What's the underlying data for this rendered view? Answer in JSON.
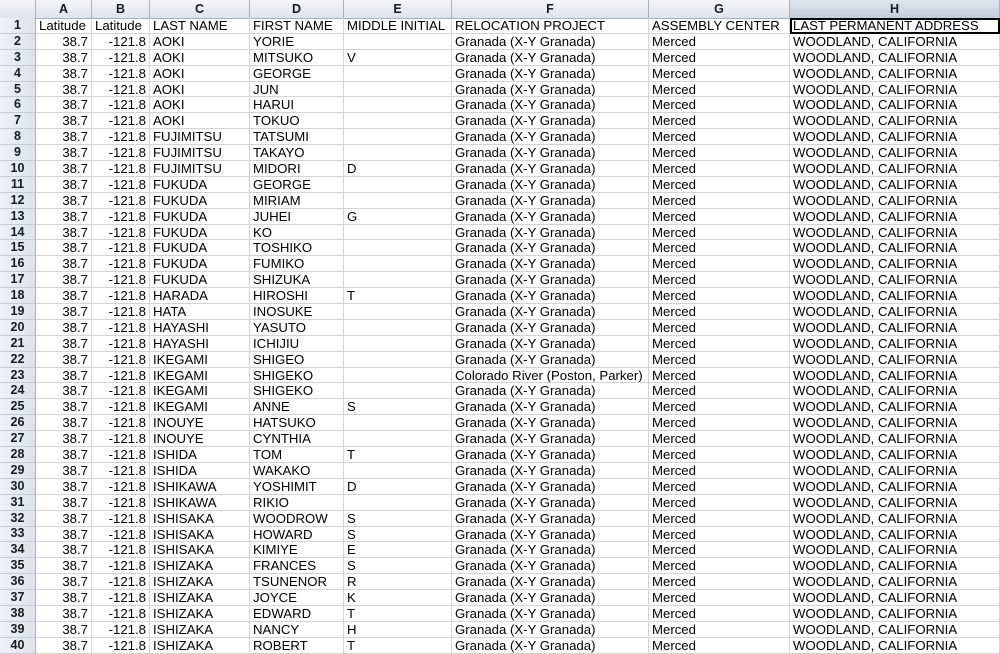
{
  "columns": [
    {
      "letter": "A"
    },
    {
      "letter": "B"
    },
    {
      "letter": "C"
    },
    {
      "letter": "D"
    },
    {
      "letter": "E"
    },
    {
      "letter": "F"
    },
    {
      "letter": "G"
    },
    {
      "letter": "H"
    }
  ],
  "header": [
    "Latitude",
    "Latitude",
    "LAST NAME",
    "FIRST NAME",
    "MIDDLE INITIAL",
    "RELOCATION PROJECT",
    "ASSEMBLY CENTER",
    "LAST PERMANENT ADDRESS"
  ],
  "rows": [
    [
      "2",
      "38.7",
      "-121.8",
      "AOKI",
      "YORIE",
      "",
      "Granada (X-Y Granada)",
      "Merced",
      "WOODLAND, CALIFORNIA"
    ],
    [
      "3",
      "38.7",
      "-121.8",
      "AOKI",
      "MITSUKO",
      "V",
      "Granada (X-Y Granada)",
      "Merced",
      "WOODLAND, CALIFORNIA"
    ],
    [
      "4",
      "38.7",
      "-121.8",
      "AOKI",
      "GEORGE",
      "",
      "Granada (X-Y Granada)",
      "Merced",
      "WOODLAND, CALIFORNIA"
    ],
    [
      "5",
      "38.7",
      "-121.8",
      "AOKI",
      "JUN",
      "",
      "Granada (X-Y Granada)",
      "Merced",
      "WOODLAND, CALIFORNIA"
    ],
    [
      "6",
      "38.7",
      "-121.8",
      "AOKI",
      "HARUI",
      "",
      "Granada (X-Y Granada)",
      "Merced",
      "WOODLAND, CALIFORNIA"
    ],
    [
      "7",
      "38.7",
      "-121.8",
      "AOKI",
      "TOKUO",
      "",
      "Granada (X-Y Granada)",
      "Merced",
      "WOODLAND, CALIFORNIA"
    ],
    [
      "8",
      "38.7",
      "-121.8",
      "FUJIMITSU",
      "TATSUMI",
      "",
      "Granada (X-Y Granada)",
      "Merced",
      "WOODLAND, CALIFORNIA"
    ],
    [
      "9",
      "38.7",
      "-121.8",
      "FUJIMITSU",
      "TAKAYO",
      "",
      "Granada (X-Y Granada)",
      "Merced",
      "WOODLAND, CALIFORNIA"
    ],
    [
      "10",
      "38.7",
      "-121.8",
      "FUJIMITSU",
      "MIDORI",
      "D",
      "Granada (X-Y Granada)",
      "Merced",
      "WOODLAND, CALIFORNIA"
    ],
    [
      "11",
      "38.7",
      "-121.8",
      "FUKUDA",
      "GEORGE",
      "",
      "Granada (X-Y Granada)",
      "Merced",
      "WOODLAND, CALIFORNIA"
    ],
    [
      "12",
      "38.7",
      "-121.8",
      "FUKUDA",
      "MIRIAM",
      "",
      "Granada (X-Y Granada)",
      "Merced",
      "WOODLAND, CALIFORNIA"
    ],
    [
      "13",
      "38.7",
      "-121.8",
      "FUKUDA",
      "JUHEI",
      "G",
      "Granada (X-Y Granada)",
      "Merced",
      "WOODLAND, CALIFORNIA"
    ],
    [
      "14",
      "38.7",
      "-121.8",
      "FUKUDA",
      "KO",
      "",
      "Granada (X-Y Granada)",
      "Merced",
      "WOODLAND, CALIFORNIA"
    ],
    [
      "15",
      "38.7",
      "-121.8",
      "FUKUDA",
      "TOSHIKO",
      "",
      "Granada (X-Y Granada)",
      "Merced",
      "WOODLAND, CALIFORNIA"
    ],
    [
      "16",
      "38.7",
      "-121.8",
      "FUKUDA",
      "FUMIKO",
      "",
      "Granada (X-Y Granada)",
      "Merced",
      "WOODLAND, CALIFORNIA"
    ],
    [
      "17",
      "38.7",
      "-121.8",
      "FUKUDA",
      "SHIZUKA",
      "",
      "Granada (X-Y Granada)",
      "Merced",
      "WOODLAND, CALIFORNIA"
    ],
    [
      "18",
      "38.7",
      "-121.8",
      "HARADA",
      "HIROSHI",
      "T",
      "Granada (X-Y Granada)",
      "Merced",
      "WOODLAND, CALIFORNIA"
    ],
    [
      "19",
      "38.7",
      "-121.8",
      "HATA",
      "INOSUKE",
      "",
      "Granada (X-Y Granada)",
      "Merced",
      "WOODLAND, CALIFORNIA"
    ],
    [
      "20",
      "38.7",
      "-121.8",
      "HAYASHI",
      "YASUTO",
      "",
      "Granada (X-Y Granada)",
      "Merced",
      "WOODLAND, CALIFORNIA"
    ],
    [
      "21",
      "38.7",
      "-121.8",
      "HAYASHI",
      "ICHIJIU",
      "",
      "Granada (X-Y Granada)",
      "Merced",
      "WOODLAND, CALIFORNIA"
    ],
    [
      "22",
      "38.7",
      "-121.8",
      "IKEGAMI",
      "SHIGEO",
      "",
      "Granada (X-Y Granada)",
      "Merced",
      "WOODLAND, CALIFORNIA"
    ],
    [
      "23",
      "38.7",
      "-121.8",
      "IKEGAMI",
      "SHIGEKO",
      "",
      "Colorado River (Poston, Parker)",
      "Merced",
      "WOODLAND, CALIFORNIA"
    ],
    [
      "24",
      "38.7",
      "-121.8",
      "IKEGAMI",
      "SHIGEKO",
      "",
      "Granada (X-Y Granada)",
      "Merced",
      "WOODLAND, CALIFORNIA"
    ],
    [
      "25",
      "38.7",
      "-121.8",
      "IKEGAMI",
      "ANNE",
      "S",
      "Granada (X-Y Granada)",
      "Merced",
      "WOODLAND, CALIFORNIA"
    ],
    [
      "26",
      "38.7",
      "-121.8",
      "INOUYE",
      "HATSUKO",
      "",
      "Granada (X-Y Granada)",
      "Merced",
      "WOODLAND, CALIFORNIA"
    ],
    [
      "27",
      "38.7",
      "-121.8",
      "INOUYE",
      "CYNTHIA",
      "",
      "Granada (X-Y Granada)",
      "Merced",
      "WOODLAND, CALIFORNIA"
    ],
    [
      "28",
      "38.7",
      "-121.8",
      "ISHIDA",
      "TOM",
      "T",
      "Granada (X-Y Granada)",
      "Merced",
      "WOODLAND, CALIFORNIA"
    ],
    [
      "29",
      "38.7",
      "-121.8",
      "ISHIDA",
      "WAKAKO",
      "",
      "Granada (X-Y Granada)",
      "Merced",
      "WOODLAND, CALIFORNIA"
    ],
    [
      "30",
      "38.7",
      "-121.8",
      "ISHIKAWA",
      "YOSHIMIT",
      "D",
      "Granada (X-Y Granada)",
      "Merced",
      "WOODLAND, CALIFORNIA"
    ],
    [
      "31",
      "38.7",
      "-121.8",
      "ISHIKAWA",
      "RIKIO",
      "",
      "Granada (X-Y Granada)",
      "Merced",
      "WOODLAND, CALIFORNIA"
    ],
    [
      "32",
      "38.7",
      "-121.8",
      "ISHISAKA",
      "WOODROW",
      "S",
      "Granada (X-Y Granada)",
      "Merced",
      "WOODLAND, CALIFORNIA"
    ],
    [
      "33",
      "38.7",
      "-121.8",
      "ISHISAKA",
      "HOWARD",
      "S",
      "Granada (X-Y Granada)",
      "Merced",
      "WOODLAND, CALIFORNIA"
    ],
    [
      "34",
      "38.7",
      "-121.8",
      "ISHISAKA",
      "KIMIYE",
      "E",
      "Granada (X-Y Granada)",
      "Merced",
      "WOODLAND, CALIFORNIA"
    ],
    [
      "35",
      "38.7",
      "-121.8",
      "ISHIZAKA",
      "FRANCES",
      "S",
      "Granada (X-Y Granada)",
      "Merced",
      "WOODLAND, CALIFORNIA"
    ],
    [
      "36",
      "38.7",
      "-121.8",
      "ISHIZAKA",
      "TSUNENOR",
      "R",
      "Granada (X-Y Granada)",
      "Merced",
      "WOODLAND, CALIFORNIA"
    ],
    [
      "37",
      "38.7",
      "-121.8",
      "ISHIZAKA",
      "JOYCE",
      "K",
      "Granada (X-Y Granada)",
      "Merced",
      "WOODLAND, CALIFORNIA"
    ],
    [
      "38",
      "38.7",
      "-121.8",
      "ISHIZAKA",
      "EDWARD",
      "T",
      "Granada (X-Y Granada)",
      "Merced",
      "WOODLAND, CALIFORNIA"
    ],
    [
      "39",
      "38.7",
      "-121.8",
      "ISHIZAKA",
      "NANCY",
      "H",
      "Granada (X-Y Granada)",
      "Merced",
      "WOODLAND, CALIFORNIA"
    ],
    [
      "40",
      "38.7",
      "-121.8",
      "ISHIZAKA",
      "ROBERT",
      "T",
      "Granada (X-Y Granada)",
      "Merced",
      "WOODLAND, CALIFORNIA"
    ]
  ],
  "selected_cell": "H1"
}
